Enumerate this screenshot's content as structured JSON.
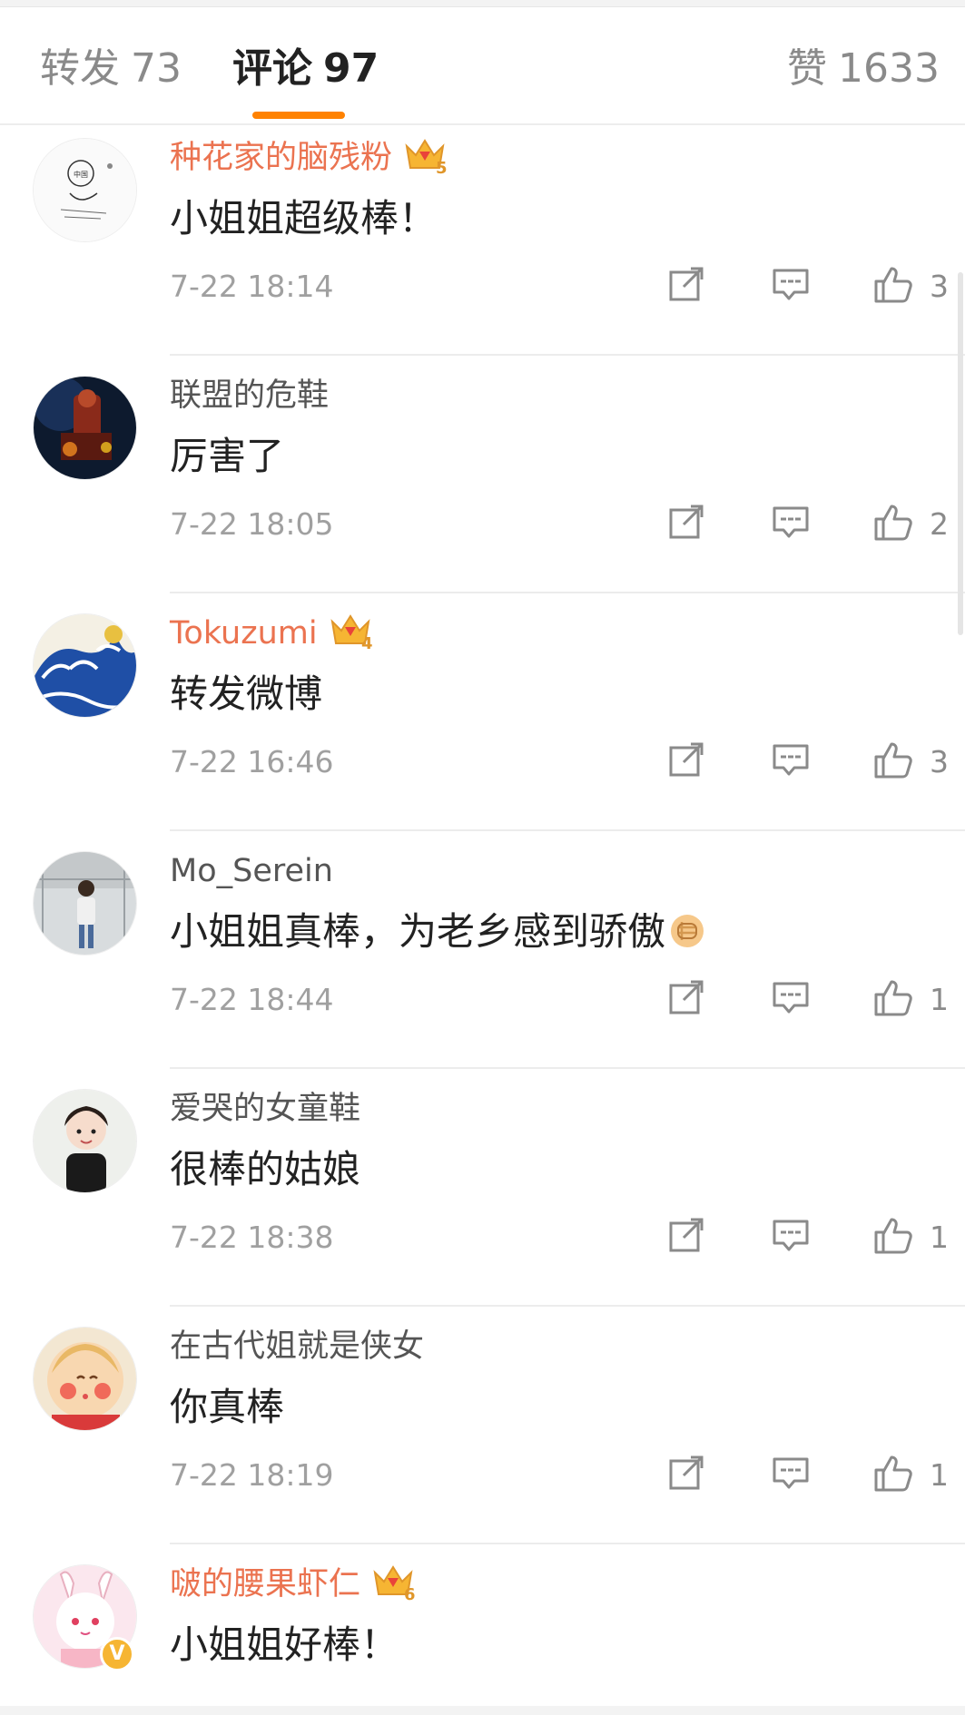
{
  "tabs": {
    "repost": {
      "label": "转发",
      "count": "73"
    },
    "comments": {
      "label": "评论",
      "count": "97"
    },
    "likes": {
      "label": "赞",
      "count": "1633"
    }
  },
  "colors": {
    "accent": "#ff8200",
    "vip_name": "#eb7350",
    "crown": "#f6b533"
  },
  "comments": [
    {
      "username": "种花家的脑残粉",
      "vip": true,
      "vip_level": "5",
      "text": "小姐姐超级棒！",
      "time": "7-22 18:14",
      "likes": "3",
      "avatar": "sketch-avatar"
    },
    {
      "username": "联盟的危鞋",
      "vip": false,
      "text": "厉害了",
      "time": "7-22 18:05",
      "likes": "2",
      "avatar": "game-hero-avatar"
    },
    {
      "username": "Tokuzumi",
      "vip": true,
      "vip_level": "4",
      "text": "转发微博",
      "time": "7-22 16:46",
      "likes": "3",
      "avatar": "wave-painting-avatar"
    },
    {
      "username": "Mo_Serein",
      "vip": false,
      "text": "小姐姐真棒，为老乡感到骄傲",
      "emoji": "fist-emoji",
      "time": "7-22 18:44",
      "likes": "1",
      "avatar": "photo-avatar"
    },
    {
      "username": "爱哭的女童鞋",
      "vip": false,
      "text": "很棒的姑娘",
      "time": "7-22 18:38",
      "likes": "1",
      "avatar": "selfie-avatar"
    },
    {
      "username": "在古代姐就是侠女",
      "vip": false,
      "text": "你真棒",
      "time": "7-22 18:19",
      "likes": "1",
      "avatar": "cartoon-face-avatar"
    },
    {
      "username": "啵的腰果虾仁",
      "vip": true,
      "vip_level": "6",
      "verified": "V",
      "text": "小姐姐好棒！",
      "avatar": "anime-bunny-avatar"
    }
  ]
}
